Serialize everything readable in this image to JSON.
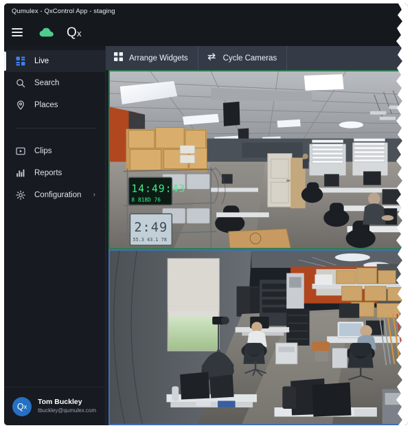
{
  "window": {
    "title": "Qumulex - QxControl App - staging"
  },
  "header": {
    "menu_icon": "hamburger-icon",
    "cloud_icon": "cloud-logo-icon",
    "cloud_color": "#4ecb8e",
    "brand_main": "Q",
    "brand_sub": "x"
  },
  "sidebar": {
    "items": [
      {
        "label": "Live",
        "icon": "grid-dashboard-icon",
        "active": true,
        "chevron": ""
      },
      {
        "label": "Search",
        "icon": "search-icon",
        "active": false,
        "chevron": ""
      },
      {
        "label": "Places",
        "icon": "map-pin-icon",
        "active": false,
        "chevron": ""
      },
      {
        "label": "Clips",
        "icon": "video-clip-icon",
        "active": false,
        "chevron": ""
      },
      {
        "label": "Reports",
        "icon": "bar-chart-icon",
        "active": false,
        "chevron": ""
      },
      {
        "label": "Configuration",
        "icon": "gear-icon",
        "active": false,
        "chevron": "›"
      }
    ],
    "active_accent": "#f0f2f6",
    "active_icon_color": "#3b82f6",
    "profile": {
      "avatar_initials_main": "Q",
      "avatar_initials_sub": "x",
      "avatar_color": "#2570c4",
      "name": "Tom Buckley",
      "email": "tbuckley@qumulex.com"
    }
  },
  "toolbar": {
    "buttons": [
      {
        "label": "Arrange Widgets",
        "icon": "grid-widgets-icon"
      },
      {
        "label": "Cycle Cameras",
        "icon": "cycle-arrows-icon"
      }
    ]
  },
  "video_grid": {
    "tiles": [
      {
        "name": "camera-feed-warehouse-office",
        "border_color": "#2e7d4f",
        "scene": "Warehouse / open office interior with exposed ceiling, fluorescent light fixtures, orange accent wall at left, stacked cardboard boxes on wire shelving, two digital LED clocks, white door at center, desks with monitors and office chairs at right, a seated person working."
      },
      {
        "name": "camera-feed-lab-office",
        "border_color": "#3f6fb5",
        "scene": "Overhead wide-angle view of a lab/office bay: grey wall with a large shaded window at left, camera on tripod, workbenches and equipment racks, orange accent wall and stacked boxes at the rear, two seated people at desks, rolling office chairs, monitors on tables in the foreground."
      }
    ]
  }
}
